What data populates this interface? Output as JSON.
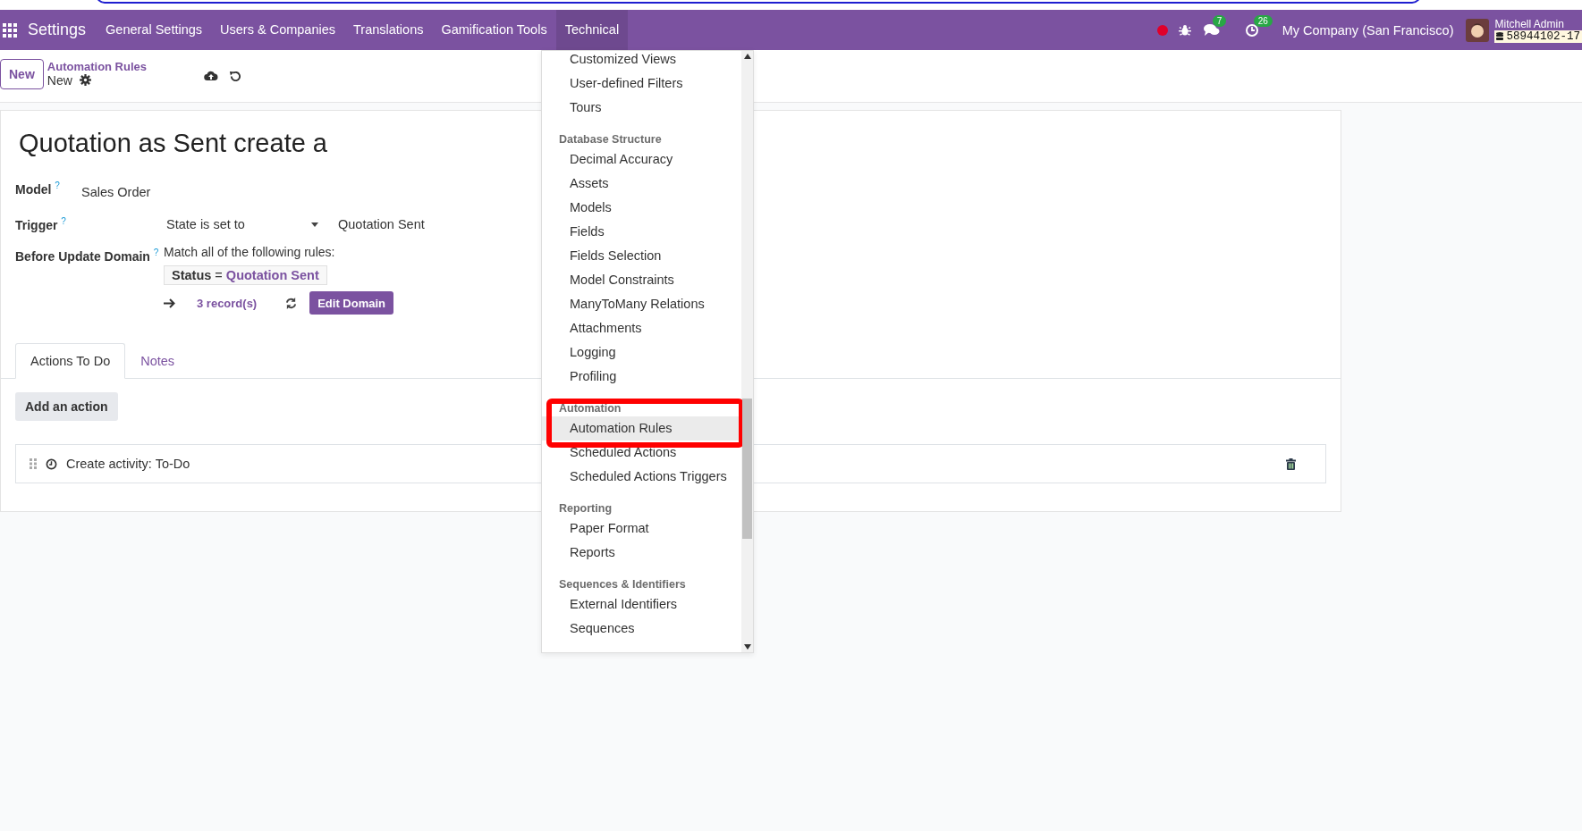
{
  "navbar": {
    "app_name": "Settings",
    "menu": [
      {
        "label": "General Settings",
        "selected": false
      },
      {
        "label": "Users & Companies",
        "selected": false
      },
      {
        "label": "Translations",
        "selected": false
      },
      {
        "label": "Gamification Tools",
        "selected": false
      },
      {
        "label": "Technical",
        "selected": true
      }
    ],
    "chat_count": "7",
    "activity_count": "26",
    "company": "My Company (San Francisco)",
    "user_name": "Mitchell Admin",
    "database": "58944102-17"
  },
  "control_panel": {
    "new_button": "New",
    "breadcrumb": "Automation Rules",
    "record": "New"
  },
  "form": {
    "title": "Quotation as Sent create a",
    "model_label": "Model",
    "model_help": "?",
    "model_value": "Sales Order",
    "trigger_label": "Trigger",
    "trigger_help": "?",
    "trigger_value": "State is set to",
    "trigger_state": "Quotation Sent",
    "domain_label": "Before Update Domain",
    "domain_help": "?",
    "domain_intro": "Match all of the following rules:",
    "rule_field": "Status",
    "rule_operator": "=",
    "rule_value": "Quotation Sent",
    "records": "3 record(s)",
    "edit_domain": "Edit Domain"
  },
  "tabs": [
    {
      "label": "Actions To Do",
      "selected": true
    },
    {
      "label": "Notes",
      "selected": false
    }
  ],
  "add_action": "Add an action",
  "actions": [
    {
      "label": "Create activity: To-Do"
    }
  ],
  "dropdown": {
    "sections": [
      {
        "items": [
          {
            "label": "Customized Views",
            "selected": false
          },
          {
            "label": "User-defined Filters",
            "selected": false
          },
          {
            "label": "Tours",
            "selected": false
          }
        ]
      },
      {
        "header": "Database Structure",
        "items": [
          {
            "label": "Decimal Accuracy",
            "selected": false
          },
          {
            "label": "Assets",
            "selected": false
          },
          {
            "label": "Models",
            "selected": false
          },
          {
            "label": "Fields",
            "selected": false
          },
          {
            "label": "Fields Selection",
            "selected": false
          },
          {
            "label": "Model Constraints",
            "selected": false
          },
          {
            "label": "ManyToMany Relations",
            "selected": false
          },
          {
            "label": "Attachments",
            "selected": false
          },
          {
            "label": "Logging",
            "selected": false
          },
          {
            "label": "Profiling",
            "selected": false
          }
        ]
      },
      {
        "header": "Automation",
        "highlighted": true,
        "items": [
          {
            "label": "Automation Rules",
            "selected": true
          },
          {
            "label": "Scheduled Actions",
            "selected": false
          },
          {
            "label": "Scheduled Actions Triggers",
            "selected": false
          }
        ]
      },
      {
        "header": "Reporting",
        "items": [
          {
            "label": "Paper Format",
            "selected": false
          },
          {
            "label": "Reports",
            "selected": false
          }
        ]
      },
      {
        "header": "Sequences & Identifiers",
        "items": [
          {
            "label": "External Identifiers",
            "selected": false
          },
          {
            "label": "Sequences",
            "selected": false
          }
        ]
      }
    ]
  }
}
